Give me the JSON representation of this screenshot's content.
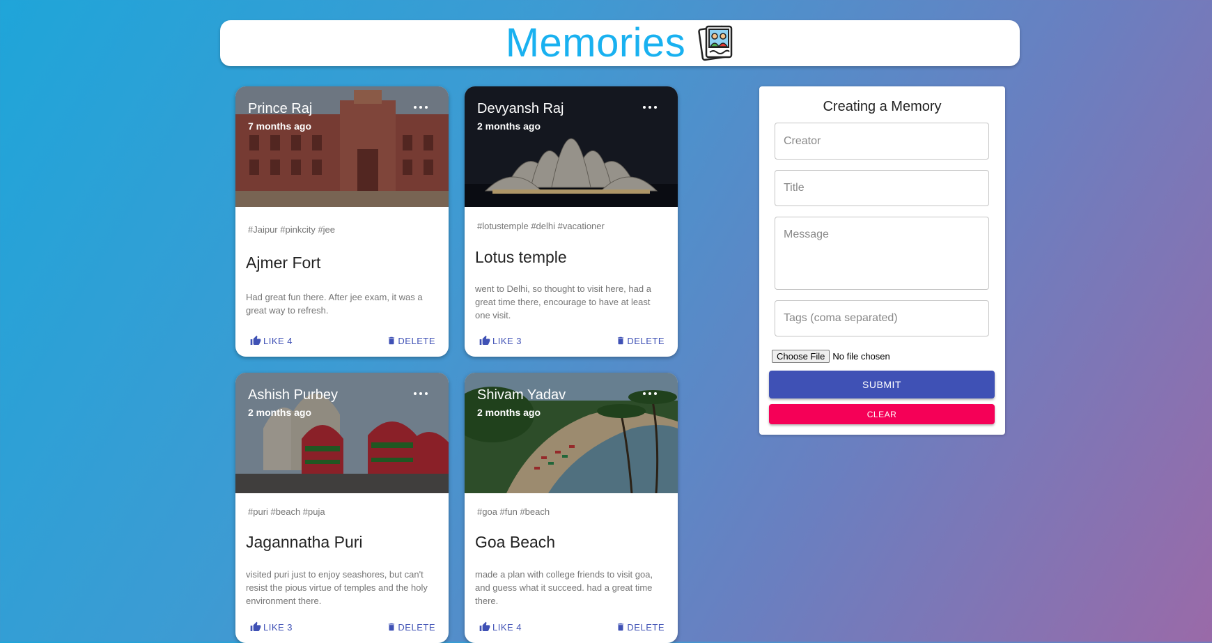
{
  "app": {
    "title": "Memories",
    "logo_icon": "memories-photo-icon"
  },
  "posts": [
    {
      "creator": "Prince Raj",
      "time": "7 months ago",
      "tags": "#Jaipur #pinkcity #jee",
      "title": "Ajmer Fort",
      "message": "Had great fun there. After jee exam, it was a great way to refresh.",
      "like_label": "LIKE 4",
      "delete_label": "DELETE"
    },
    {
      "creator": "Devyansh Raj",
      "time": "2 months ago",
      "tags": "#lotustemple #delhi #vacationer",
      "title": "Lotus temple",
      "message": "went to Delhi, so thought to visit here, had a great time there, encourage to have at least one visit.",
      "like_label": "LIKE 3",
      "delete_label": "DELETE"
    },
    {
      "creator": "Ashish Purbey",
      "time": "2 months ago",
      "tags": "#puri #beach #puja",
      "title": "Jagannatha Puri",
      "message": "visited puri just to enjoy seashores, but can't resist the pious virtue of temples and the holy environment there.",
      "like_label": "LIKE 3",
      "delete_label": "DELETE"
    },
    {
      "creator": "Shivam Yadav",
      "time": "2 months ago",
      "tags": "#goa #fun #beach",
      "title": "Goa Beach",
      "message": "made a plan with college friends to visit goa, and guess what it succeed. had a great time there.",
      "like_label": "LIKE 4",
      "delete_label": "DELETE"
    }
  ],
  "form": {
    "title": "Creating a Memory",
    "creator_placeholder": "Creator",
    "title_placeholder": "Title",
    "message_placeholder": "Message",
    "tags_placeholder": "Tags (coma separated)",
    "file_button": "Choose File",
    "file_status": "No file chosen",
    "submit_label": "SUBMIT",
    "clear_label": "CLEAR"
  },
  "colors": {
    "accent": "#3f51b5",
    "secondary": "#f50057",
    "title_blue": "#19b1f0"
  }
}
